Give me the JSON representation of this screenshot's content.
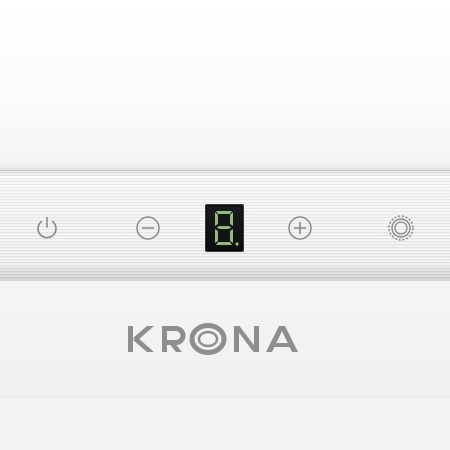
{
  "brand": {
    "logo_text": "KRONA",
    "color": "#8e8e8e"
  },
  "controls": {
    "buttons": [
      {
        "id": "power",
        "icon": "power-icon"
      },
      {
        "id": "minus",
        "icon": "minus-circle-icon"
      },
      {
        "id": "plus",
        "icon": "plus-circle-icon"
      },
      {
        "id": "light",
        "icon": "light-gear-icon"
      }
    ],
    "display": {
      "digit": "8",
      "segment_color_lit": "#8dbf7a",
      "segment_color_dim": "#3a4a36",
      "background": "#111111"
    },
    "icon_color": "#8a8a8a"
  }
}
